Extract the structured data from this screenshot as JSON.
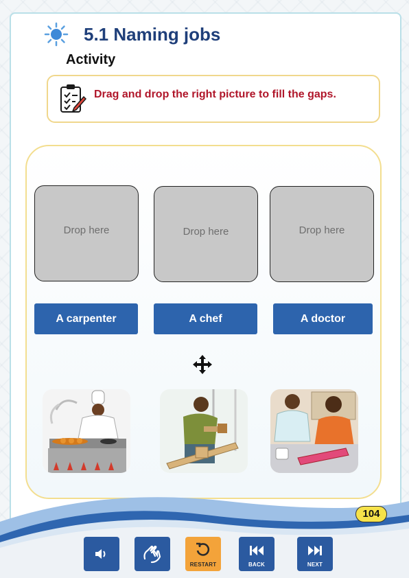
{
  "header": {
    "title": "5.1 Naming jobs",
    "section": "Activity"
  },
  "instruction": {
    "text": "Drag and drop the right picture to fill the gaps."
  },
  "drop_zones": [
    {
      "label": "Drop here"
    },
    {
      "label": "Drop here"
    },
    {
      "label": "Drop here"
    }
  ],
  "words": [
    {
      "label": "A carpenter"
    },
    {
      "label": "A chef"
    },
    {
      "label": "A doctor"
    }
  ],
  "pictures": [
    {
      "icon": "chef-image"
    },
    {
      "icon": "carpenter-image"
    },
    {
      "icon": "doctor-image"
    }
  ],
  "page_number": "104",
  "nav": {
    "restart_label": "RESTART",
    "back_label": "BACK",
    "next_label": "NEXT"
  },
  "colors": {
    "title": "#1f3f7a",
    "instruction": "#b0162a",
    "word_button": "#2d64ad",
    "drop_zone": "#c8c8c8",
    "restart": "#f3a33a",
    "nav": "#2b5aa0"
  }
}
